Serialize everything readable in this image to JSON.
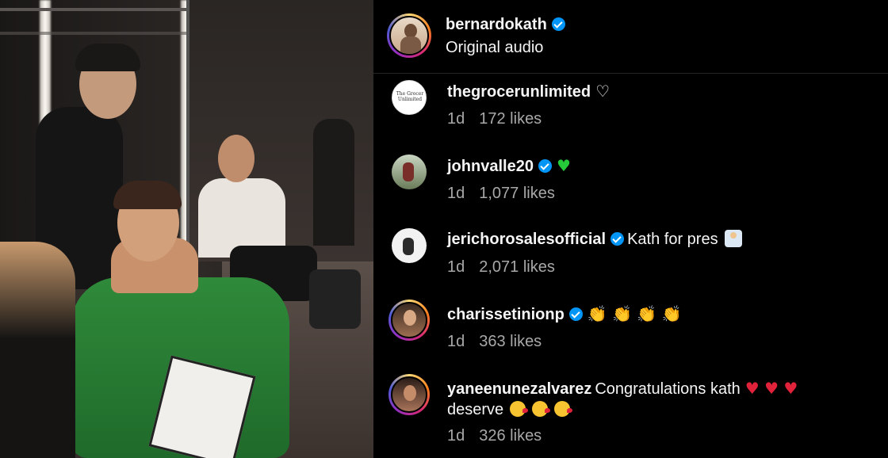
{
  "header": {
    "username": "bernardokath",
    "subtitle": "Original audio"
  },
  "comments": [
    {
      "username": "thegrocerunlimited",
      "verified": false,
      "text": "",
      "emoji": "♡",
      "emoji_kind": "heart-white",
      "age": "1d",
      "likes": "172 likes",
      "avatar_text": "The Grocer Unlimited"
    },
    {
      "username": "johnvalle20",
      "verified": true,
      "text": "",
      "emoji": "♥",
      "emoji_kind": "heart-green",
      "age": "1d",
      "likes": "1,077 likes"
    },
    {
      "username": "jerichorosalesofficial",
      "verified": true,
      "text": "Kath for pres",
      "emoji": "raise-hand",
      "emoji_kind": "raise",
      "age": "1d",
      "likes": "2,071 likes"
    },
    {
      "username": "charissetinionp",
      "verified": true,
      "text": "",
      "emoji": "👏 👏 👏 👏",
      "emoji_kind": "clap",
      "age": "1d",
      "likes": "363 likes"
    },
    {
      "username": "yaneenunezalvarez",
      "verified": false,
      "text": "Congratulations kath",
      "emoji": "♥ ♥ ♥",
      "emoji_kind": "heart-red",
      "text2": "deserve",
      "emoji2": "wink",
      "age": "1d",
      "likes": "326 likes"
    }
  ],
  "colors": {
    "background": "#000000",
    "text": "#f5f5f5",
    "meta": "#a8a8a8",
    "verified": "#0095f6",
    "divider": "#262626"
  }
}
